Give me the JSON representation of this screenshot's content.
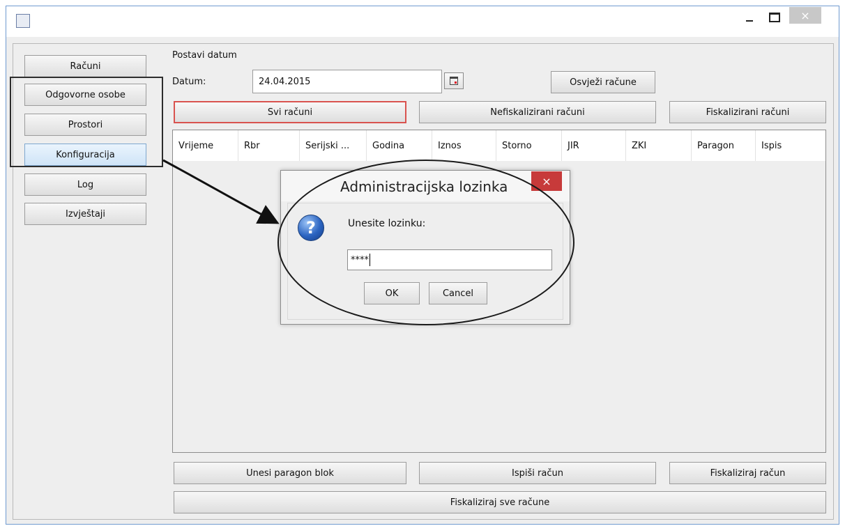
{
  "window": {
    "minimize_glyph": "–",
    "close_glyph": "×"
  },
  "sidebar": {
    "items": [
      {
        "label": "Računi"
      },
      {
        "label": "Odgovorne osobe"
      },
      {
        "label": "Prostori"
      },
      {
        "label": "Konfiguracija",
        "selected": true
      },
      {
        "label": "Log"
      },
      {
        "label": "Izvještaji"
      }
    ]
  },
  "date_section": {
    "title": "Postavi datum",
    "date_label": "Datum:",
    "date_value": "24.04.2015",
    "refresh_button": "Osvježi račune"
  },
  "filter_tabs": [
    {
      "label": "Svi računi",
      "active": true
    },
    {
      "label": "Nefiskalizirani računi"
    },
    {
      "label": "Fiskalizirani računi"
    }
  ],
  "table": {
    "columns": [
      "Vrijeme",
      "Rbr",
      "Serijski ...",
      "Godina",
      "Iznos",
      "Storno",
      "JIR",
      "ZKI",
      "Paragon",
      "Ispis"
    ]
  },
  "actions": {
    "enter_paragon": "Unesi paragon blok",
    "print_invoice": "Ispiši račun",
    "fiscalize_invoice": "Fiskaliziraj račun",
    "fiscalize_all": "Fiskaliziraj sve račune"
  },
  "dialog": {
    "title": "Administracijska lozinka",
    "prompt": "Unesite lozinku:",
    "password_value": "****",
    "ok_label": "OK",
    "cancel_label": "Cancel",
    "close_glyph": "×",
    "icon_glyph": "?"
  },
  "colors": {
    "active_tab_border": "#d9534f",
    "dialog_close": "#c73a3a",
    "selected_item": "#cfe4f7"
  }
}
